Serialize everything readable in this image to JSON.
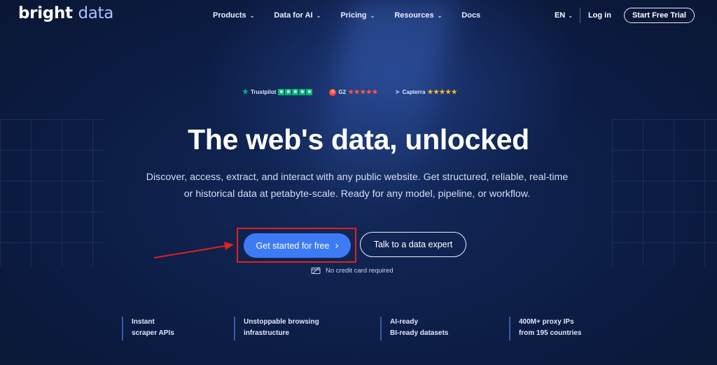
{
  "logo": {
    "part1": "bright",
    "part2": "data"
  },
  "nav": {
    "items": [
      {
        "label": "Products",
        "has_dropdown": true
      },
      {
        "label": "Data for AI",
        "has_dropdown": true
      },
      {
        "label": "Pricing",
        "has_dropdown": true
      },
      {
        "label": "Resources",
        "has_dropdown": true
      },
      {
        "label": "Docs",
        "has_dropdown": false
      }
    ],
    "language": "EN",
    "login": "Log in",
    "trial_button": "Start Free Trial"
  },
  "ratings": [
    {
      "name": "Trustpilot",
      "stars": 5,
      "color": "#00b67a"
    },
    {
      "name": "G2",
      "stars": 4.5,
      "color": "#ff492c"
    },
    {
      "name": "Capterra",
      "stars": 5,
      "color": "#ffb92e"
    }
  ],
  "hero": {
    "headline": "The web's data, unlocked",
    "subtitle_line1": "Discover, access, extract, and interact with any public website. Get structured, reliable, real-time",
    "subtitle_line2": "or historical data at petabyte-scale. Ready for any model, pipeline, or workflow."
  },
  "cta": {
    "primary": "Get started for free",
    "secondary": "Talk to a data expert",
    "note": "No credit card required"
  },
  "features": [
    {
      "line1": "Instant",
      "line2": "scraper APIs"
    },
    {
      "line1": "Unstoppable browsing",
      "line2": "infrastructure"
    },
    {
      "line1": "AI-ready",
      "line2": "BI-ready datasets"
    },
    {
      "line1": "400M+ proxy IPs",
      "line2": "from 195 countries"
    }
  ],
  "colors": {
    "background": "#0b1a3d",
    "primary_button": "#3d7bf5",
    "highlight_box": "#e0211b"
  }
}
